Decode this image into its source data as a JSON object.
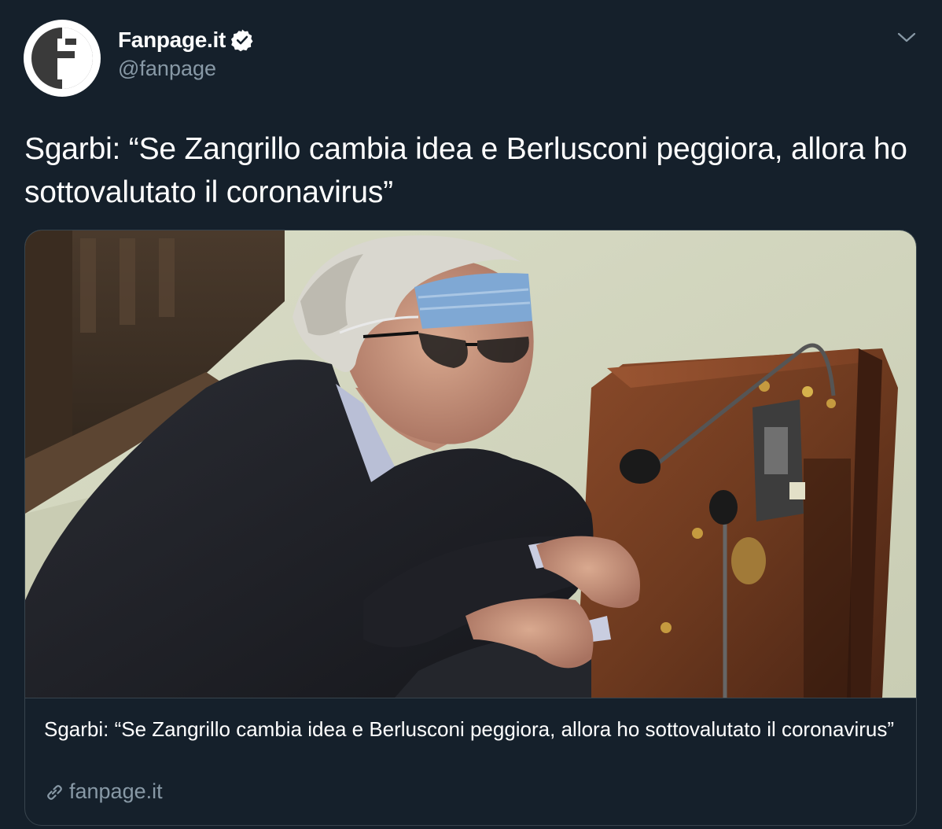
{
  "author": {
    "display_name": "Fanpage.it",
    "handle": "@fanpage",
    "verified": true
  },
  "tweet": {
    "text": "Sgarbi: “Se Zangrillo cambia idea e Berlusconi peggiora, allora ho sottovalutato il coronavirus”"
  },
  "card": {
    "title": "Sgarbi: “Se Zangrillo cambia idea e Berlusconi peggiora, allora ho sottovalutato il coronavirus”",
    "domain": "fanpage.it"
  },
  "icons": {
    "verified": "verified-badge-icon",
    "caret": "chevron-down-icon",
    "link": "link-icon"
  },
  "colors": {
    "background": "#15202b",
    "secondary_text": "#8899a6",
    "border": "#38444d"
  }
}
